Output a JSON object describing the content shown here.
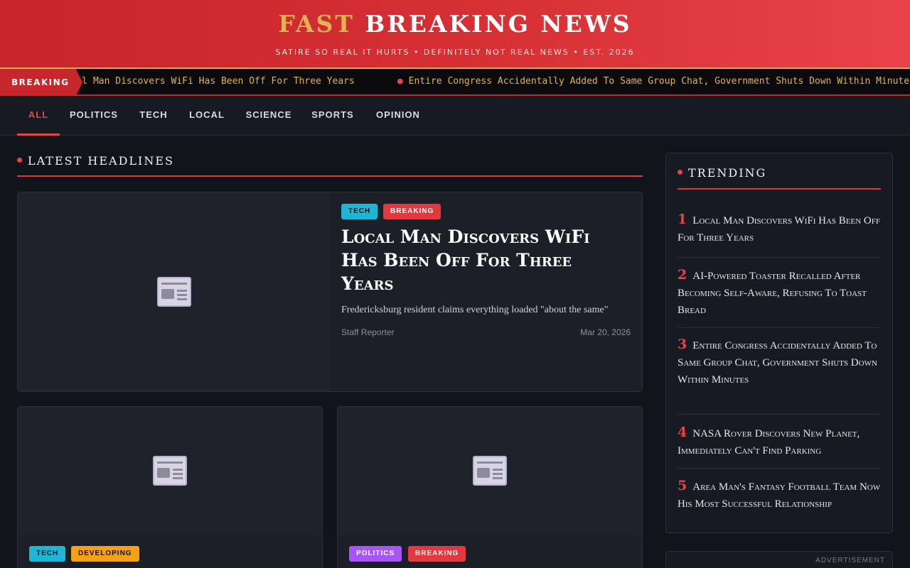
{
  "site": {
    "title_accent": "FAST",
    "title_rest": "BREAKING NEWS",
    "tagline": "SATIRE SO REAL IT HURTS • DEFINITELY NOT REAL NEWS • EST. 2026"
  },
  "ticker": {
    "label": "BREAKING",
    "items": [
      "Local Man Discovers WiFi Has Been Off For Three Years",
      "Entire Congress Accidentally Added To Same Group Chat, Government Shuts Down Within Minutes"
    ]
  },
  "nav": {
    "items": [
      "ALL",
      "POLITICS",
      "TECH",
      "LOCAL",
      "SCIENCE",
      "SPORTS",
      "OPINION"
    ],
    "active": "ALL"
  },
  "latest": {
    "title": "LATEST HEADLINES",
    "featured": {
      "tags": [
        "TECH",
        "BREAKING"
      ],
      "headline": "Local Man Discovers WiFi Has Been Off For Three Years",
      "summary": "Fredericksburg resident claims everything loaded \"about the same\"",
      "author": "Staff Reporter",
      "date": "Mar 20, 2026",
      "image_icon": "newspaper-icon"
    },
    "cards": [
      {
        "tags": [
          "TECH",
          "DEVELOPING"
        ],
        "image_icon": "newspaper-icon"
      },
      {
        "tags": [
          "POLITICS",
          "BREAKING"
        ],
        "image_icon": "newspaper-icon"
      }
    ]
  },
  "trending": {
    "title": "TRENDING",
    "items": [
      {
        "num": "1",
        "text": "Local Man Discovers WiFi Has Been Off For Three Years"
      },
      {
        "num": "2",
        "text": "AI-Powered Toaster Recalled After Becoming Self-Aware, Refusing To Toast Bread"
      },
      {
        "num": "3",
        "text": "Entire Congress Accidentally Added To Same Group Chat, Government Shuts Down Within Minutes"
      },
      {
        "num": "4",
        "text": "NASA Rover Discovers New Planet, Immediately Can't Find Parking"
      },
      {
        "num": "5",
        "text": "Area Man's Fantasy Football Team Now His Most Successful Relationship"
      }
    ]
  },
  "ad": {
    "label": "ADVERTISEMENT"
  },
  "colors": {
    "brand_red": "#c7262c",
    "accent_gold": "#e2b255",
    "tag_tech": "#1fb5d4",
    "tag_breaking": "#e0393e",
    "tag_developing": "#f3a116",
    "tag_politics": "#a855f7"
  }
}
